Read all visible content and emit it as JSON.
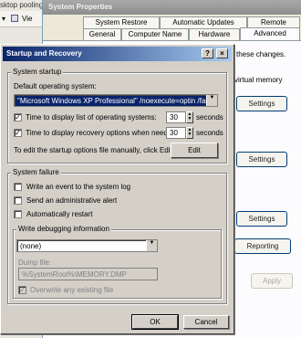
{
  "background": {
    "explorer_text_1": "sktop pooling p",
    "explorer_view_label": "Vie"
  },
  "system_properties": {
    "title": "System Properties",
    "tabs_row1": [
      "System Restore",
      "Automatic Updates",
      "Remote"
    ],
    "tabs_row2": [
      "General",
      "Computer Name",
      "Hardware",
      "Advanced"
    ],
    "text_changes": "these changes.",
    "text_virtual_memory": "virtual memory",
    "settings_1": "Settings",
    "settings_2": "Settings",
    "settings_3": "Settings",
    "reporting": "Reporting",
    "apply": "Apply"
  },
  "dialog": {
    "title": "Startup and Recovery",
    "help": "?",
    "close": "×",
    "startup": {
      "group_label": "System startup",
      "default_os_label": "Default operating system:",
      "default_os_value": "\"Microsoft Windows XP Professional\" /noexecute=optin /fastdete",
      "time_list_label": "Time to display list of operating systems:",
      "time_list_value": "30",
      "time_recovery_label": "Time to display recovery options when needed:",
      "time_recovery_value": "30",
      "seconds_1": "seconds",
      "seconds_2": "seconds",
      "edit_hint": "To edit the startup options file manually, click Edit.",
      "edit_button": "Edit"
    },
    "failure": {
      "group_label": "System failure",
      "write_event": "Write an event to the system log",
      "send_alert": "Send an administrative alert",
      "auto_restart": "Automatically restart",
      "debug_group_label": "Write debugging information",
      "debug_value": "(none)",
      "dump_file_label": "Dump file:",
      "dump_file_value": "%SystemRoot%\\MEMORY.DMP",
      "overwrite_label": "Overwrite any existing file"
    },
    "ok": "OK",
    "cancel": "Cancel"
  }
}
